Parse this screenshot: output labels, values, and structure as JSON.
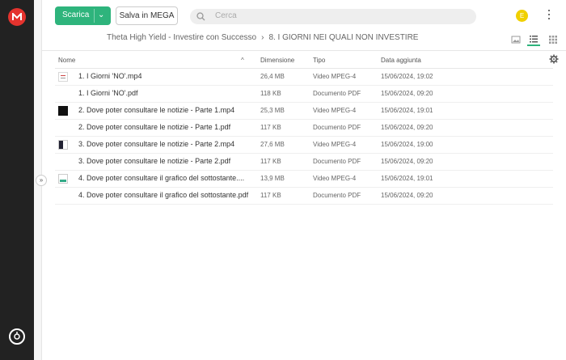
{
  "toolbar": {
    "download_label": "Scarica",
    "save_label": "Salva in MEGA",
    "search_placeholder": "Cerca",
    "avatar_initial": "E"
  },
  "breadcrumb": {
    "root": "Theta High Yield - Investire con Successo",
    "current": "8. I GIORNI NEI QUALI NON INVESTIRE"
  },
  "table": {
    "columns": {
      "name": "Nome",
      "size": "Dimensione",
      "type": "Tipo",
      "date": "Data aggiunta"
    },
    "rows": [
      {
        "thumb": "doc",
        "name": "1. I Giorni 'NO'.mp4",
        "size": "26,4 MB",
        "type": "Video MPEG-4",
        "date": "15/06/2024, 19:02"
      },
      {
        "thumb": "none",
        "name": "1. I Giorni 'NO'.pdf",
        "size": "118 KB",
        "type": "Documento PDF",
        "date": "15/06/2024, 09:20"
      },
      {
        "thumb": "dark",
        "name": "2. Dove poter consultare le notizie - Parte 1.mp4",
        "size": "25,3 MB",
        "type": "Video MPEG-4",
        "date": "15/06/2024, 19:01"
      },
      {
        "thumb": "none",
        "name": "2. Dove poter consultare le notizie - Parte 1.pdf",
        "size": "117 KB",
        "type": "Documento PDF",
        "date": "15/06/2024, 09:20"
      },
      {
        "thumb": "mixed",
        "name": "3. Dove poter consultare le notizie - Parte 2.mp4",
        "size": "27,6 MB",
        "type": "Video MPEG-4",
        "date": "15/06/2024, 19:00"
      },
      {
        "thumb": "none",
        "name": "3. Dove poter consultare le notizie - Parte 2.pdf",
        "size": "117 KB",
        "type": "Documento PDF",
        "date": "15/06/2024, 09:20"
      },
      {
        "thumb": "chart",
        "name": "4. Dove poter consultare il grafico del sottostante....",
        "size": "13,9 MB",
        "type": "Video MPEG-4",
        "date": "15/06/2024, 19:01"
      },
      {
        "thumb": "none",
        "name": "4. Dove poter consultare il grafico del sottostante.pdf",
        "size": "117 KB",
        "type": "Documento PDF",
        "date": "15/06/2024, 09:20"
      }
    ]
  },
  "colors": {
    "accent": "#2eb47c",
    "brand": "#e4332e",
    "sidebar": "#222222"
  },
  "icons": [
    "mega-logo-icon",
    "chevron-down-icon",
    "search-icon",
    "kebab-menu-icon",
    "thumbnail-view-icon",
    "list-view-icon",
    "grid-view-icon",
    "sort-ascending-icon",
    "settings-gear-icon",
    "expand-icon",
    "transfers-icon"
  ]
}
